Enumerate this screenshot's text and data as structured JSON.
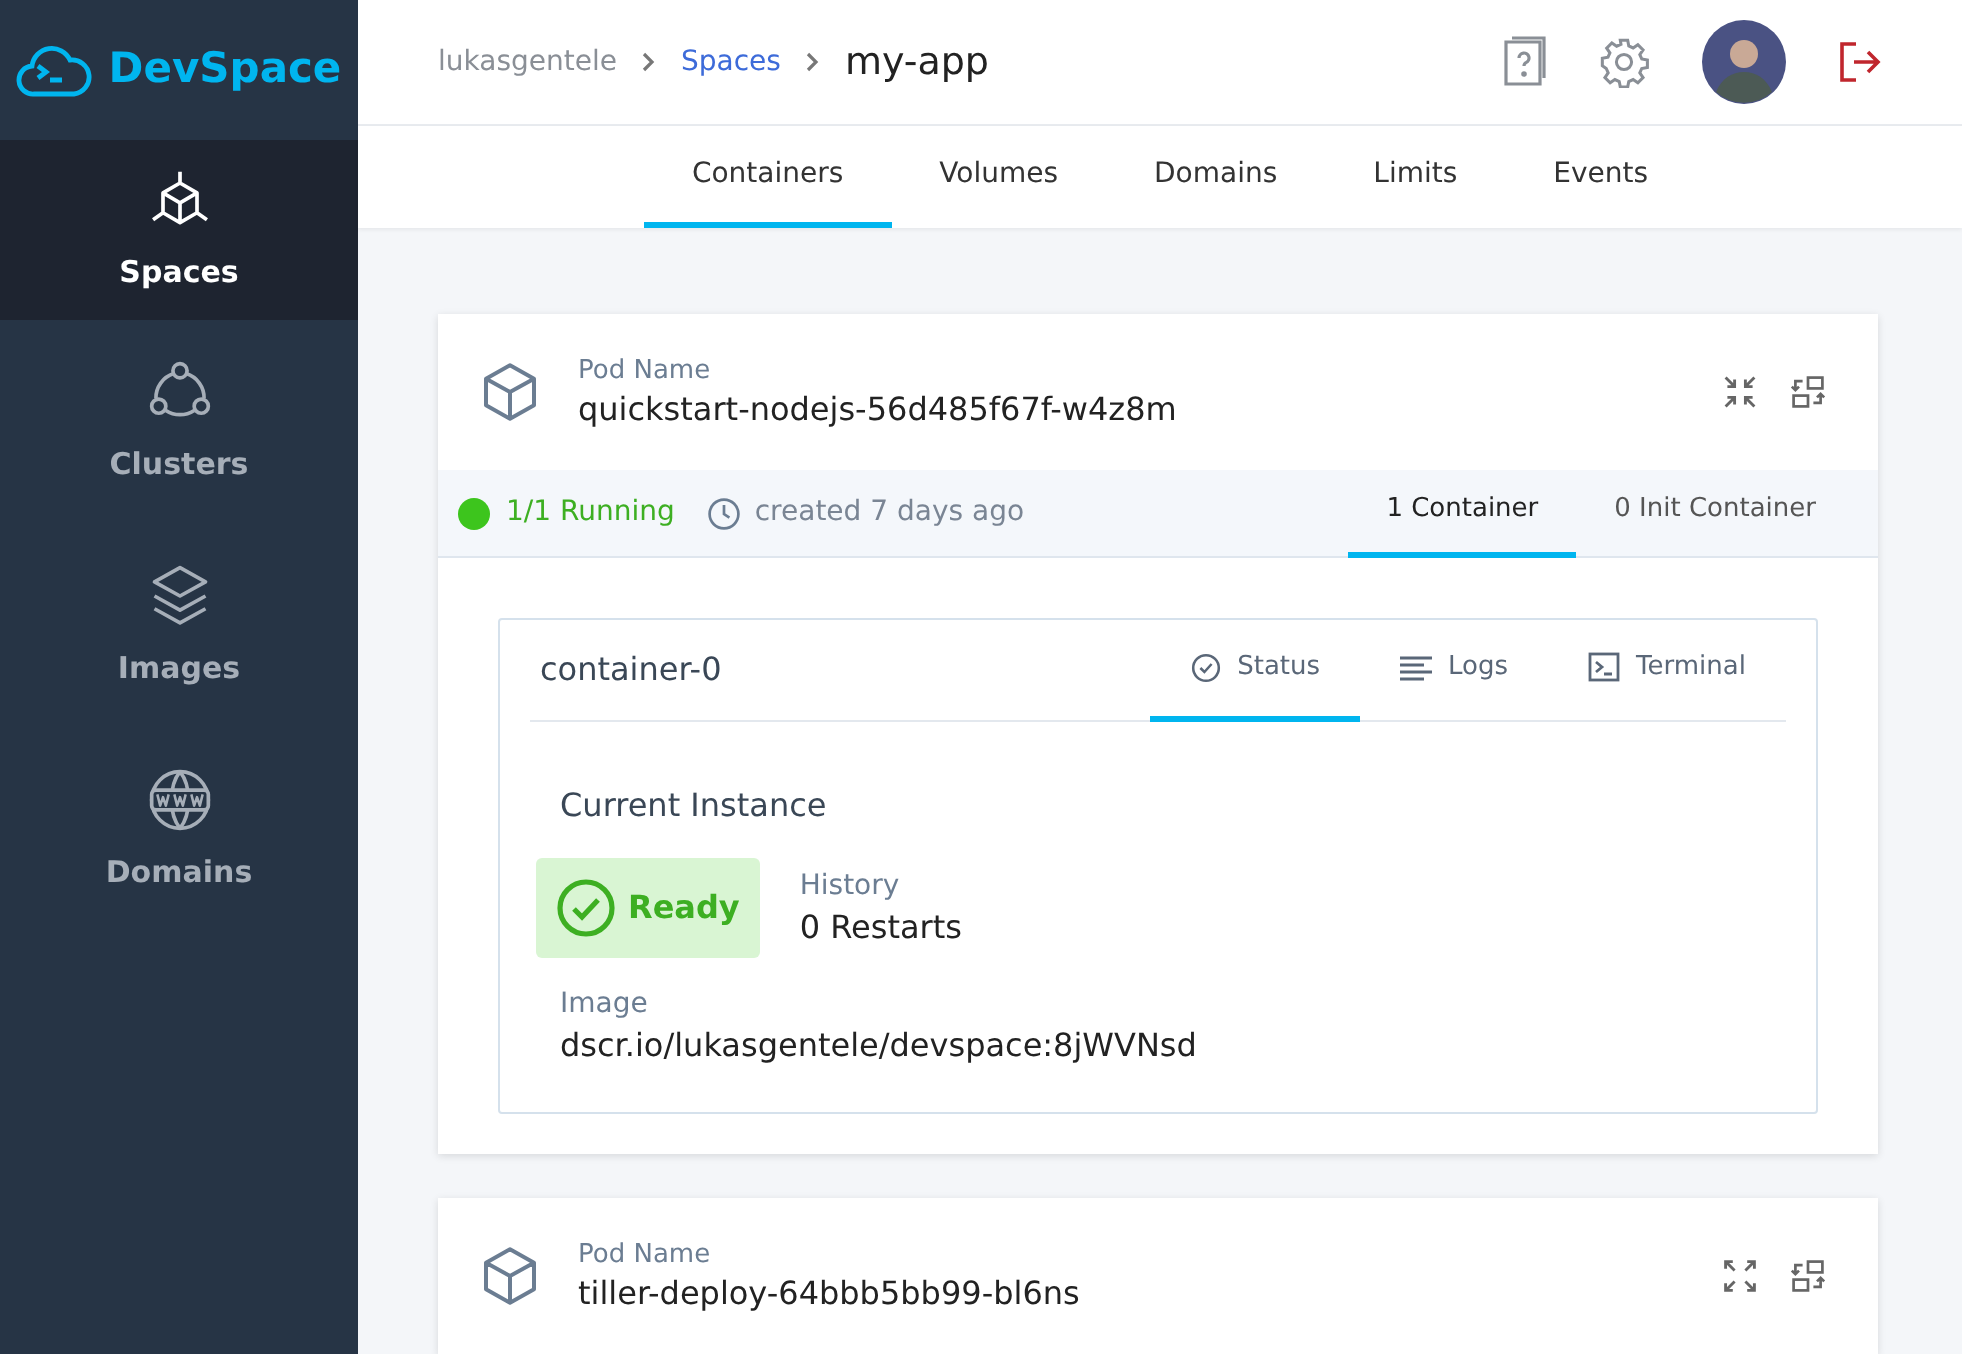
{
  "logo": {
    "text": "DevSpace"
  },
  "sidebar": {
    "items": [
      {
        "label": "Spaces",
        "selected": true
      },
      {
        "label": "Clusters",
        "selected": false
      },
      {
        "label": "Images",
        "selected": false
      },
      {
        "label": "Domains",
        "selected": false
      }
    ]
  },
  "breadcrumb": [
    {
      "label": "lukasgentele",
      "kind": "text"
    },
    {
      "label": "Spaces",
      "kind": "link"
    },
    {
      "label": "my-app",
      "kind": "current"
    }
  ],
  "tabs": [
    {
      "label": "Containers",
      "selected": true
    },
    {
      "label": "Volumes",
      "selected": false
    },
    {
      "label": "Domains",
      "selected": false
    },
    {
      "label": "Limits",
      "selected": false
    },
    {
      "label": "Events",
      "selected": false
    }
  ],
  "pods": [
    {
      "label": "Pod Name",
      "name": "quickstart-nodejs-56d485f67f-w4z8m",
      "expanded": true,
      "status": "1/1 Running",
      "created": "created 7 days ago",
      "container_tabs": [
        {
          "label": "1 Container",
          "selected": true
        },
        {
          "label": "0 Init Container",
          "selected": false
        }
      ],
      "containers": [
        {
          "name": "container-0",
          "tabs": [
            {
              "label": "Status",
              "selected": true
            },
            {
              "label": "Logs",
              "selected": false
            },
            {
              "label": "Terminal",
              "selected": false
            }
          ],
          "section_title": "Current Instance",
          "state": "Ready",
          "history_label": "History",
          "history": "0 Restarts",
          "image_label": "Image",
          "image": "dscr.io/lukasgentele/devspace:8jWVNsd"
        }
      ]
    },
    {
      "label": "Pod Name",
      "name": "tiller-deploy-64bbb5bb99-bl6ns",
      "expanded": false
    }
  ]
}
